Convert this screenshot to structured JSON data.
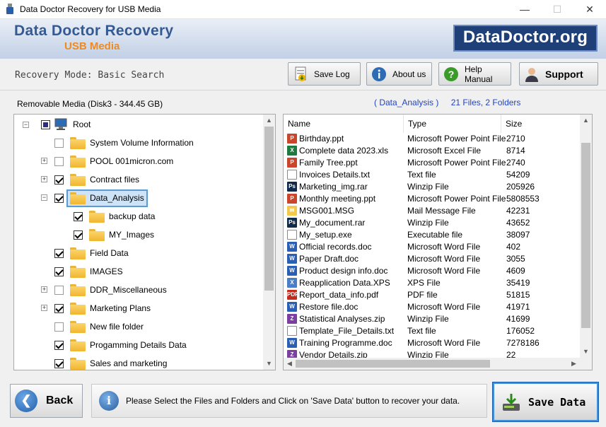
{
  "window": {
    "title": "Data Doctor Recovery for USB Media",
    "minimize": "—",
    "maximize": "☐",
    "close": "✕"
  },
  "banner": {
    "title": "Data Doctor Recovery",
    "subtitle": "USB Media",
    "logo": "DataDoctor.org"
  },
  "mode": {
    "label": "Recovery Mode: Basic Search"
  },
  "toolbar": {
    "save_log": "Save Log",
    "about_us": "About us",
    "help_manual": "Help Manual",
    "support": "Support"
  },
  "media": {
    "label": "Removable Media (Disk3 - 344.45 GB)"
  },
  "summary": {
    "folder": "( Data_Analysis )",
    "counts": "21 Files, 2 Folders"
  },
  "tree": {
    "root": "Root",
    "items": [
      {
        "label": "System Volume Information",
        "checked": false
      },
      {
        "label": "POOL 001micron.com",
        "checked": false
      },
      {
        "label": "Contract files",
        "checked": true
      },
      {
        "label": "Data_Analysis",
        "checked": true
      },
      {
        "label": "backup data",
        "checked": true
      },
      {
        "label": "MY_Images",
        "checked": true
      },
      {
        "label": "Field Data",
        "checked": true
      },
      {
        "label": "IMAGES",
        "checked": true
      },
      {
        "label": "DDR_Miscellaneous",
        "checked": false
      },
      {
        "label": "Marketing Plans",
        "checked": true
      },
      {
        "label": "New file folder",
        "checked": false
      },
      {
        "label": "Progamming Details Data",
        "checked": true
      },
      {
        "label": "Sales and marketing",
        "checked": true
      }
    ]
  },
  "list": {
    "columns": [
      "Name",
      "Type",
      "Size"
    ],
    "rows": [
      {
        "name": "Birthday.ppt",
        "type": "Microsoft Power Point File",
        "size": "2710",
        "icon": "ppt"
      },
      {
        "name": "Complete data 2023.xls",
        "type": "Microsoft Excel File",
        "size": "8714",
        "icon": "xls"
      },
      {
        "name": "Family Tree.ppt",
        "type": "Microsoft Power Point File",
        "size": "2740",
        "icon": "ppt"
      },
      {
        "name": "Invoices Details.txt",
        "type": "Text file",
        "size": "54209",
        "icon": "txt"
      },
      {
        "name": "Marketing_img.rar",
        "type": "Winzip File",
        "size": "205926",
        "icon": "ps"
      },
      {
        "name": "Monthly meeting.ppt",
        "type": "Microsoft Power Point File",
        "size": "5808553",
        "icon": "ppt"
      },
      {
        "name": "MSG001.MSG",
        "type": "Mail Message File",
        "size": "42231",
        "icon": "msg"
      },
      {
        "name": "My_document.rar",
        "type": "Winzip File",
        "size": "43652",
        "icon": "ps"
      },
      {
        "name": "My_setup.exe",
        "type": "Executable file",
        "size": "38097",
        "icon": "exe"
      },
      {
        "name": "Official records.doc",
        "type": "Microsoft Word File",
        "size": "402",
        "icon": "doc"
      },
      {
        "name": "Paper Draft.doc",
        "type": "Microsoft Word File",
        "size": "3055",
        "icon": "doc"
      },
      {
        "name": "Product design info.doc",
        "type": "Microsoft Word File",
        "size": "4609",
        "icon": "doc"
      },
      {
        "name": "Reapplication Data.XPS",
        "type": "XPS File",
        "size": "35419",
        "icon": "xps"
      },
      {
        "name": "Report_data_info.pdf",
        "type": "PDF file",
        "size": "51815",
        "icon": "pdf"
      },
      {
        "name": "Restore file.doc",
        "type": "Microsoft Word File",
        "size": "41971",
        "icon": "doc"
      },
      {
        "name": "Statistical Analyses.zip",
        "type": "Winzip File",
        "size": "41699",
        "icon": "zip"
      },
      {
        "name": "Template_File_Details.txt",
        "type": "Text file",
        "size": "176052",
        "icon": "txt"
      },
      {
        "name": "Training Programme.doc",
        "type": "Microsoft Word File",
        "size": "7278186",
        "icon": "doc"
      },
      {
        "name": "Vendor Details.zip",
        "type": "Winzip File",
        "size": "22",
        "icon": "zip"
      }
    ]
  },
  "footer": {
    "back": "Back",
    "info": "Please Select the Files and Folders and Click on 'Save Data' button to recover your data.",
    "save": "Save Data"
  },
  "colors": {
    "accent": "#355a93",
    "orange": "#f08a1e",
    "link": "#2244c6",
    "logo_bg": "#1e3f77"
  }
}
